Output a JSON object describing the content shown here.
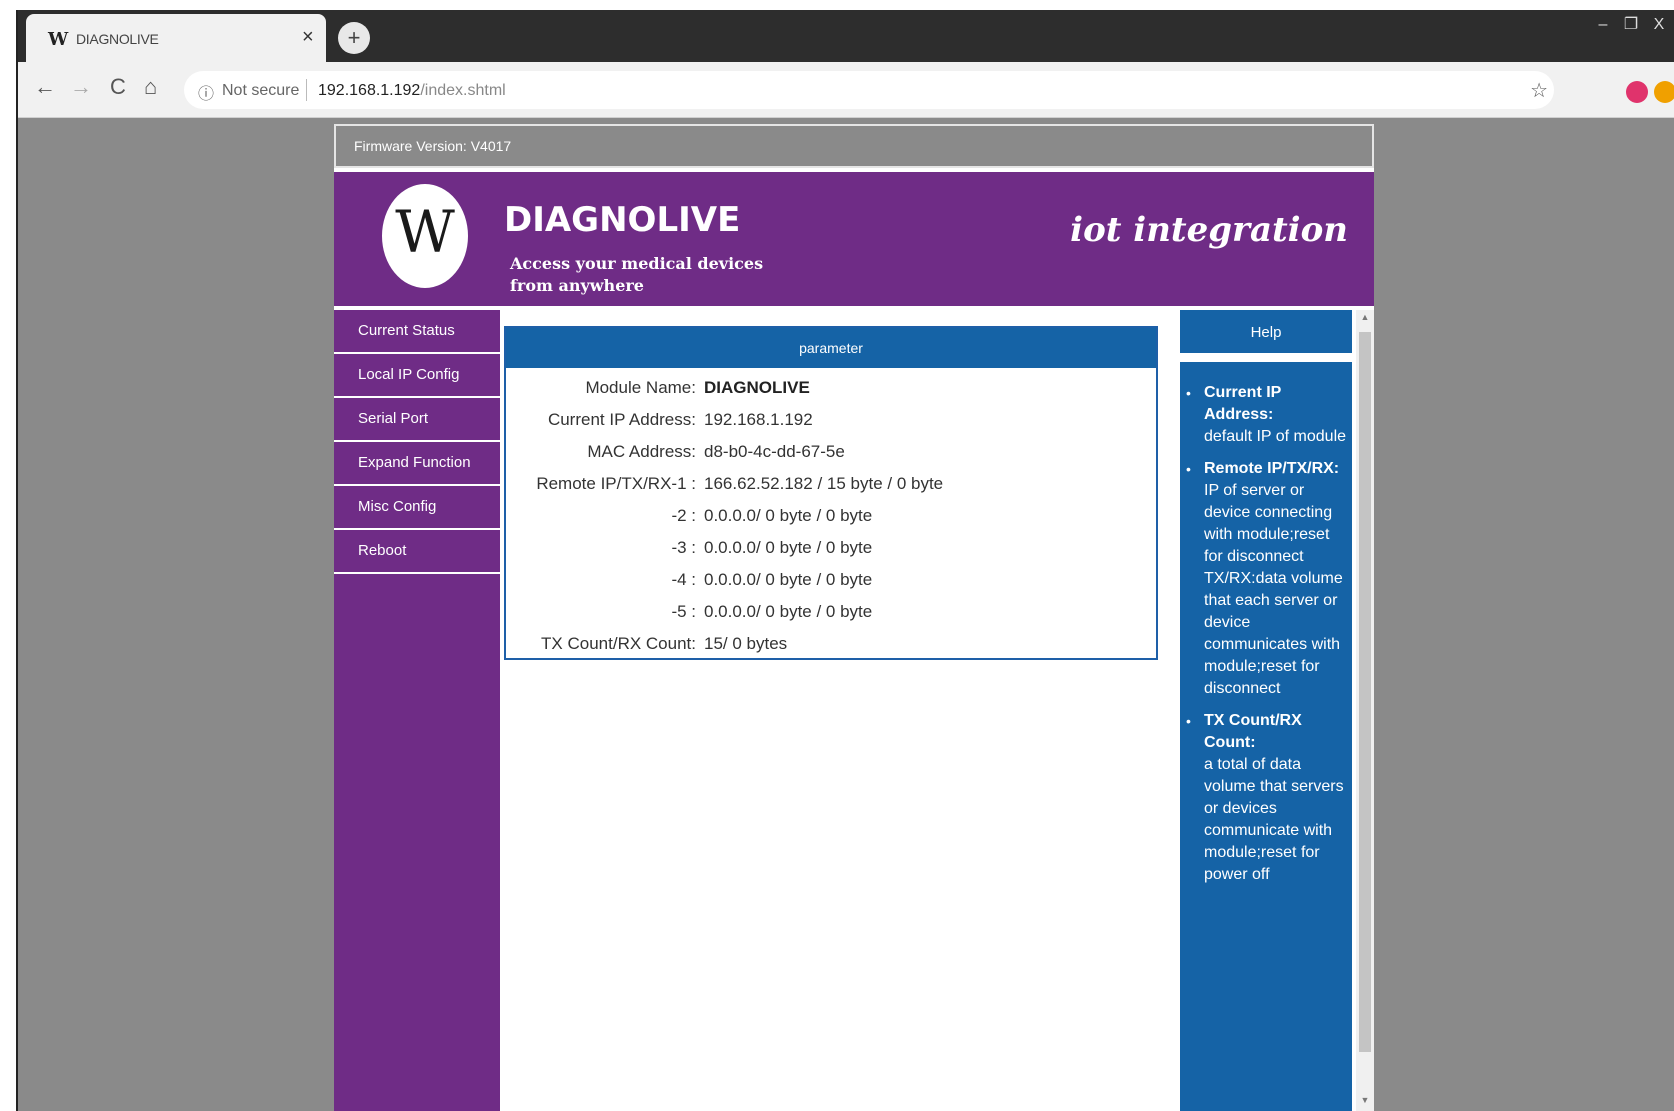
{
  "browser": {
    "tab_title": "DIAGNOLIVE",
    "tab_favicon": "W",
    "tab_close": "×",
    "new_tab": "+",
    "security_label": "Not secure",
    "url_host": "192.168.1.192",
    "url_path": "/index.shtml",
    "window_controls": {
      "minimize": "–",
      "maximize": "❐",
      "close": "X"
    },
    "nav": {
      "back": "←",
      "forward": "→",
      "reload": "C",
      "home": "⌂",
      "bookmark": "☆",
      "info": "ⓘ"
    }
  },
  "page": {
    "firmware": "Firmware Version:  V4017",
    "brand": "DIAGNOLIVE",
    "tagline_line1": "Access your medical devices",
    "tagline_line2": "from anywhere",
    "slogan": "iot integration",
    "logo_letter": "W",
    "colors": {
      "purple": "#6f2c86",
      "blue": "#1563a6",
      "gray": "#8a8a8a"
    }
  },
  "sidebar": {
    "items": [
      {
        "label": "Current Status"
      },
      {
        "label": "Local IP Config"
      },
      {
        "label": "Serial Port"
      },
      {
        "label": "Expand Function"
      },
      {
        "label": "Misc Config"
      },
      {
        "label": "Reboot"
      }
    ]
  },
  "main": {
    "header": "parameter",
    "rows": [
      {
        "label": "Module Name:",
        "value": "DIAGNOLIVE"
      },
      {
        "label": "Current IP Address:",
        "value": "192.168.1.192"
      },
      {
        "label": "MAC Address:",
        "value": "d8-b0-4c-dd-67-5e"
      },
      {
        "label": "Remote IP/TX/RX-1 :",
        "value": "166.62.52.182 / 15 byte / 0 byte"
      },
      {
        "label": "-2 :",
        "value": "0.0.0.0/ 0 byte / 0 byte"
      },
      {
        "label": "-3 :",
        "value": "0.0.0.0/ 0 byte / 0 byte"
      },
      {
        "label": "-4 :",
        "value": "0.0.0.0/ 0 byte / 0 byte"
      },
      {
        "label": "-5 :",
        "value": "0.0.0.0/ 0 byte / 0 byte"
      },
      {
        "label": "TX Count/RX Count:",
        "value": "15/ 0 bytes"
      }
    ]
  },
  "help": {
    "header": "Help",
    "items": [
      {
        "term": "Current IP Address:",
        "desc": "default IP of module"
      },
      {
        "term": "Remote IP/TX/RX:",
        "desc": "IP of server or device connecting with module;reset for disconnect TX/RX:data volume that each server or device communicates with module;reset for disconnect"
      },
      {
        "term": "TX Count/RX Count:",
        "desc": "a total of data volume that servers or devices communicate with module;reset for power off"
      }
    ]
  }
}
